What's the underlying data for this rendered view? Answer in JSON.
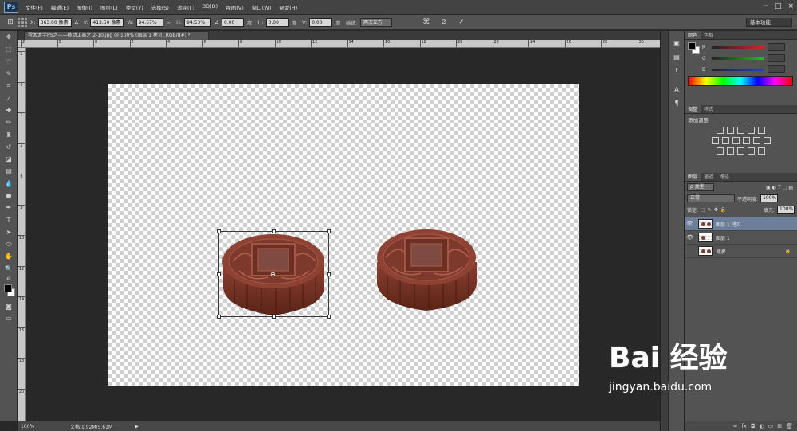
{
  "app": {
    "logo": "Ps"
  },
  "menubar": {
    "items": [
      "文件(F)",
      "编辑(E)",
      "图像(I)",
      "图层(L)",
      "类型(Y)",
      "选择(S)",
      "滤镜(T)",
      "3D(D)",
      "视图(V)",
      "窗口(W)",
      "帮助(H)"
    ],
    "window_buttons": [
      "−",
      "□",
      "×"
    ]
  },
  "optionsbar": {
    "x_label": "X:",
    "x_value": "363.00 像素",
    "y_label": "Y:",
    "y_value": "413.50 像素",
    "w_label": "W:",
    "w_value": "94.57%",
    "h_label": "H:",
    "h_value": "94.50%",
    "angle_value": "0.00",
    "angle_unit": "度",
    "hskew_label": "H:",
    "hskew_value": "0.00",
    "hskew_unit": "度",
    "vskew_label": "V:",
    "vskew_value": "0.00",
    "vskew_unit": "度",
    "interp_label": "插值:",
    "interp_value": "两次立方",
    "workspace": "基本功能"
  },
  "document": {
    "tab_title": "程太太学PS之——移动工具之 2-10.jpg @ 100% (图层 1 拷贝, RGB/8#) *",
    "zoom": "100%",
    "doc_info": "文档:1.92M/5.61M"
  },
  "rulers": {
    "top": [
      "2",
      "0",
      "0",
      "2",
      "4",
      "6",
      "8",
      "10",
      "12",
      "14",
      "16",
      "18",
      "20",
      "22",
      "24",
      "26",
      "28",
      "30"
    ],
    "left": [
      "2",
      "0",
      "2",
      "4",
      "6",
      "8",
      "10",
      "12",
      "14",
      "16",
      "18",
      "20"
    ]
  },
  "color_panel": {
    "tabs": [
      "颜色",
      "色板"
    ],
    "channels": [
      "R",
      "G",
      "B"
    ],
    "channel_colors": [
      "#e02020",
      "#20c020",
      "#2040e0"
    ]
  },
  "adjust_panel": {
    "tabs": [
      "调整",
      "样式"
    ],
    "header": "添加调整"
  },
  "layers_panel": {
    "tabs": [
      "图层",
      "通道",
      "路径"
    ],
    "filter": "ρ 类型",
    "blend_mode": "正常",
    "opacity_label": "不透明度:",
    "opacity_value": "100%",
    "lock_label": "锁定:",
    "fill_label": "填充:",
    "fill_value": "100%",
    "layers": [
      {
        "name": "图层 1 拷贝",
        "selected": true,
        "visible": true
      },
      {
        "name": "图层 1",
        "selected": false,
        "visible": true
      },
      {
        "name": "背景",
        "selected": false,
        "visible": false
      }
    ]
  },
  "watermark": {
    "logo": "Bai 经验",
    "url": "jingyan.baidu.com"
  }
}
